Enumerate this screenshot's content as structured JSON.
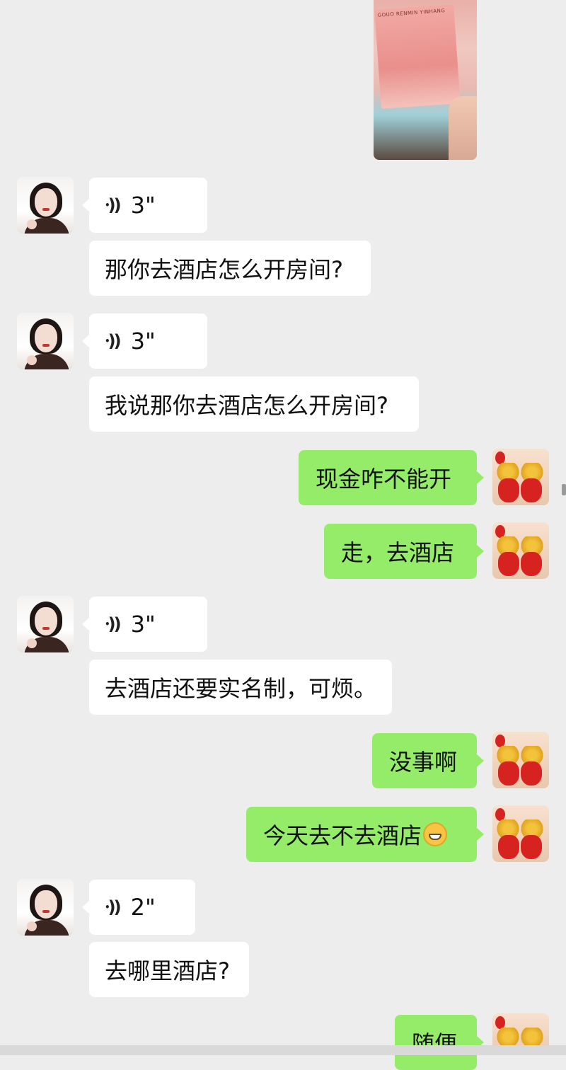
{
  "photo": {
    "note_text": "GOUO RENMIN YINHANG"
  },
  "messages": [
    {
      "from": "other",
      "kind": "voice",
      "duration": "3\""
    },
    {
      "from": "other",
      "kind": "text",
      "text": "那你去酒店怎么开房间?"
    },
    {
      "from": "other",
      "kind": "voice",
      "duration": "3\""
    },
    {
      "from": "other",
      "kind": "text",
      "text": "我说那你去酒店怎么开房间?"
    },
    {
      "from": "me",
      "kind": "text",
      "text": "现金咋不能开"
    },
    {
      "from": "me",
      "kind": "text",
      "text": "走，去酒店"
    },
    {
      "from": "other",
      "kind": "voice",
      "duration": "3\""
    },
    {
      "from": "other",
      "kind": "text",
      "text": "去酒店还要实名制，可烦。"
    },
    {
      "from": "me",
      "kind": "text",
      "text": "没事啊"
    },
    {
      "from": "me",
      "kind": "text",
      "text": "今天去不去酒店",
      "emoji": "grin-emoji"
    },
    {
      "from": "other",
      "kind": "voice",
      "duration": "2\""
    },
    {
      "from": "other",
      "kind": "text",
      "text": "去哪里酒店?"
    },
    {
      "from": "me",
      "kind": "text",
      "text": "随便"
    }
  ],
  "colors": {
    "background": "#ededed",
    "incoming_bubble": "#ffffff",
    "outgoing_bubble": "#95ec69"
  }
}
